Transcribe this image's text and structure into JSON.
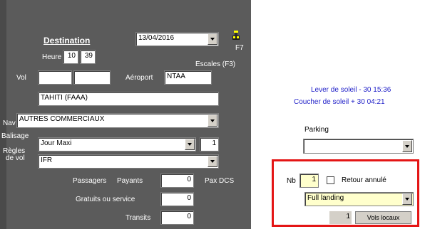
{
  "destination": {
    "title": "Destination",
    "date": "13/04/2016",
    "f7_label": "F7",
    "heure_label": "Heure",
    "heure_h": "10",
    "heure_m": "39",
    "escales_label": "Escales (F3)",
    "vol_label": "Vol",
    "vol_value1": "",
    "vol_value2": "",
    "aeroport_label": "Aéroport",
    "aeroport_code": "NTAA",
    "aeroport_name": "TAHITI (FAAA)"
  },
  "nav": {
    "label": "Nav",
    "value": "AUTRES COMMERCIAUX"
  },
  "balisage": {
    "label": "Balisage",
    "value": "Jour Maxi",
    "count": "1"
  },
  "regles": {
    "label1": "Règles",
    "label2": "de vol",
    "value": "IFR"
  },
  "passagers": {
    "label": "Passagers",
    "payants_label": "Payants",
    "payants_value": "0",
    "pax_dcs_label": "Pax DCS",
    "gratuits_label": "Gratuits ou service",
    "gratuits_value": "0",
    "transits_label": "Transits",
    "transits_value": "0"
  },
  "sun": {
    "lever": "Lever de soleil - 30  15:36",
    "coucher": "Coucher de soleil + 30  04:21"
  },
  "parking": {
    "label": "Parking",
    "value": ""
  },
  "landing": {
    "nb_label": "Nb",
    "nb_value": "1",
    "retour_label": "Retour annulé",
    "type_value": "Full landing",
    "count_value": "1",
    "vols_locaux_label": "Vols locaux"
  },
  "colors": {
    "panel": "#5b5b5b",
    "highlight_frame": "#e41515",
    "sun_text": "#1f1fc8"
  }
}
